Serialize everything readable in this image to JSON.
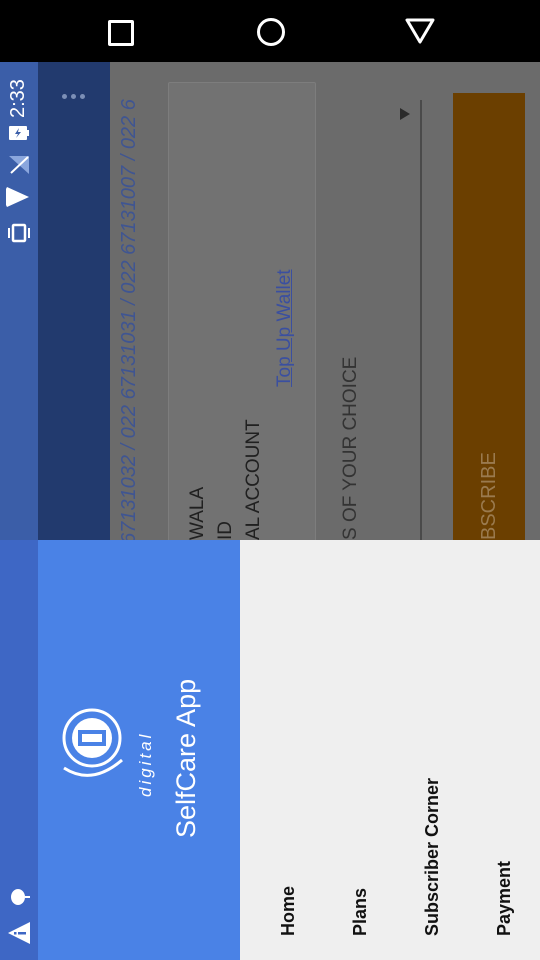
{
  "system": {
    "time": "2:33"
  },
  "background": {
    "phone_line": "67131032 / 022 67131031 / 022 67131007 / 022 6",
    "name_line": "WALA",
    "id_line": "ID",
    "account_line": "AL ACCOUNT",
    "top_up_link": "Top Up Wallet",
    "channels_hint": "S OF YOUR CHOICE",
    "subscribe_label": "BSCRIBE"
  },
  "drawer": {
    "logo_text": "digital",
    "app_title": "SelfCare App",
    "items": [
      {
        "label": "Home"
      },
      {
        "label": "Plans"
      },
      {
        "label": "Subscriber Corner"
      },
      {
        "label": "Payment"
      }
    ]
  },
  "colors": {
    "drawer_header": "#4a82e6",
    "status_bar": "#3b5ea8",
    "menu_bg": "#efefef",
    "link": "#3a4fa0"
  }
}
